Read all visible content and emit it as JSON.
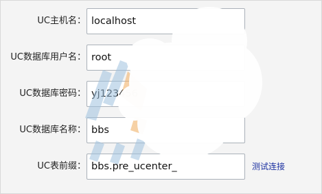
{
  "form": {
    "fields": [
      {
        "label": "UC主机名：",
        "value": "localhost"
      },
      {
        "label": "UC数据库用户名：",
        "value": "root"
      },
      {
        "label": "UC数据库密码：",
        "value": "yj123456"
      },
      {
        "label": "UC数据库名称：",
        "value": "bbs"
      },
      {
        "label": "UC表前缀：",
        "value": "bbs.pre_ucenter_"
      }
    ],
    "test_link": "测试连接"
  },
  "colors": {
    "background": "#f4f4f4",
    "field_border": "#a9b0b8",
    "link": "#1a2fa0",
    "watermark_blue": "#9fc2df",
    "watermark_orange": "#f1b36a"
  }
}
